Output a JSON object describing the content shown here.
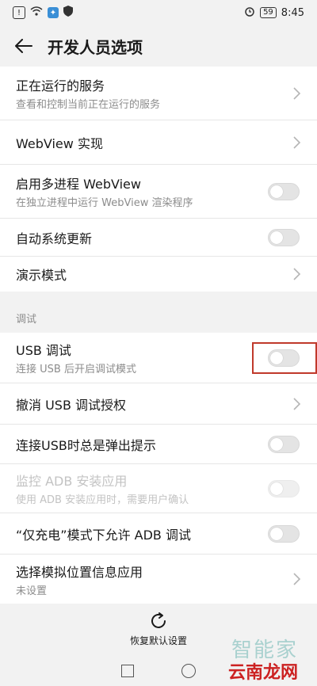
{
  "status_bar": {
    "time": "8:45",
    "battery": "59"
  },
  "header": {
    "title": "开发人员选项"
  },
  "group1": [
    {
      "label": "正在运行的服务",
      "sub": "查看和控制当前正在运行的服务",
      "control": "chevron"
    },
    {
      "label": "WebView 实现",
      "control": "chevron"
    },
    {
      "label": "启用多进程 WebView",
      "sub": "在独立进程中运行 WebView 渲染程序",
      "control": "toggle",
      "on": false
    },
    {
      "label": "自动系统更新",
      "control": "toggle",
      "on": false
    },
    {
      "label": "演示模式",
      "control": "chevron"
    }
  ],
  "section_debug": "调试",
  "group2": [
    {
      "label": "USB 调试",
      "sub": "连接 USB 后开启调试模式",
      "control": "toggle",
      "on": false
    },
    {
      "label": "撤消 USB 调试授权",
      "control": "chevron"
    },
    {
      "label": "连接USB时总是弹出提示",
      "control": "toggle",
      "on": false
    },
    {
      "label": "监控 ADB 安装应用",
      "sub": "使用 ADB 安装应用时，需要用户确认",
      "control": "toggle",
      "on": false,
      "disabled": true
    },
    {
      "label": "“仅充电”模式下允许 ADB 调试",
      "control": "toggle",
      "on": false
    },
    {
      "label": "选择模拟位置信息应用",
      "sub": "未设置",
      "control": "chevron"
    }
  ],
  "restore_label": "恢复默认设置",
  "watermark": {
    "line1": "智能家",
    "line2": "云南龙网"
  },
  "colors": {
    "highlight": "#c0392b",
    "toggle_off": "#e4e4e4",
    "secondary_text": "#8c8c8c"
  }
}
